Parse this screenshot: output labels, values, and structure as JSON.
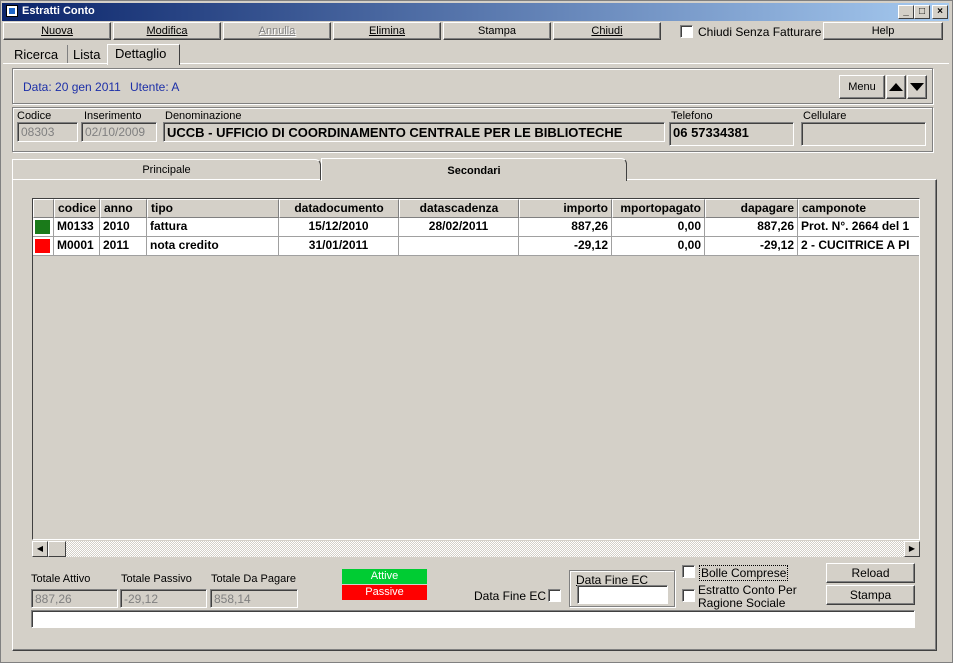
{
  "window": {
    "title": "Estratti Conto"
  },
  "toolbar": {
    "nuova": "Nuova",
    "modifica": "Modifica",
    "annulla": "Annulla",
    "elimina": "Elimina",
    "stampa": "Stampa",
    "chiudi": "Chiudi",
    "chiudi_senza_fatturare": "Chiudi Senza Fatturare",
    "help": "Help"
  },
  "top_tabs": [
    "Ricerca",
    "Lista",
    "Dettaglio"
  ],
  "info": {
    "data": "Data: 20 gen 2011",
    "utente": "Utente: A",
    "menu_label": "Menu"
  },
  "record": {
    "codice_label": "Codice",
    "codice": "08303",
    "inserimento_label": "Inserimento",
    "inserimento": "02/10/2009",
    "denominazione_label": "Denominazione",
    "denominazione": "UCCB - UFFICIO DI COORDINAMENTO CENTRALE PER LE BIBLIOTECHE",
    "telefono_label": "Telefono",
    "telefono": "06 57334381",
    "cellulare_label": "Cellulare",
    "cellulare": ""
  },
  "sub_tabs": [
    "Principale",
    "Secondari"
  ],
  "grid": {
    "headers": [
      "codice",
      "anno",
      "tipo",
      "datadocumento",
      "datascadenza",
      "importo",
      "mportopagato",
      "dapagare",
      "camponote"
    ],
    "rows": [
      {
        "status": "#1a7a1a",
        "cells": [
          "M0133",
          "2010",
          "fattura",
          "15/12/2010",
          "28/02/2011",
          "887,26",
          "0,00",
          "887,26",
          "Prot. N°. 2664 del 1"
        ]
      },
      {
        "status": "#ff0000",
        "cells": [
          "M0001",
          "2011",
          "nota credito",
          "31/01/2011",
          "",
          "-29,12",
          "0,00",
          "-29,12",
          "2 - CUCITRICE A PI"
        ]
      }
    ]
  },
  "totals": {
    "attivo_label": "Totale Attivo",
    "attivo": "887,26",
    "passivo_label": "Totale Passivo",
    "passivo": "-29,12",
    "dapagare_label": "Totale Da Pagare",
    "dapagare": "858,14"
  },
  "legend": {
    "attive": "Attive",
    "passive": "Passive",
    "attive_color": "#00cc33",
    "passive_color": "#ff0000"
  },
  "footer": {
    "data_fine_ec_check_label": "Data Fine EC",
    "data_fine_ec_group_label": "Data Fine EC",
    "data_fine_ec_value": "",
    "bolle_comprese": "Bolle Comprese",
    "estratto_conto_per": "Estratto Conto Per",
    "ragione_sociale": "Ragione Sociale",
    "reload": "Reload",
    "stampa": "Stampa",
    "status_text": ""
  }
}
